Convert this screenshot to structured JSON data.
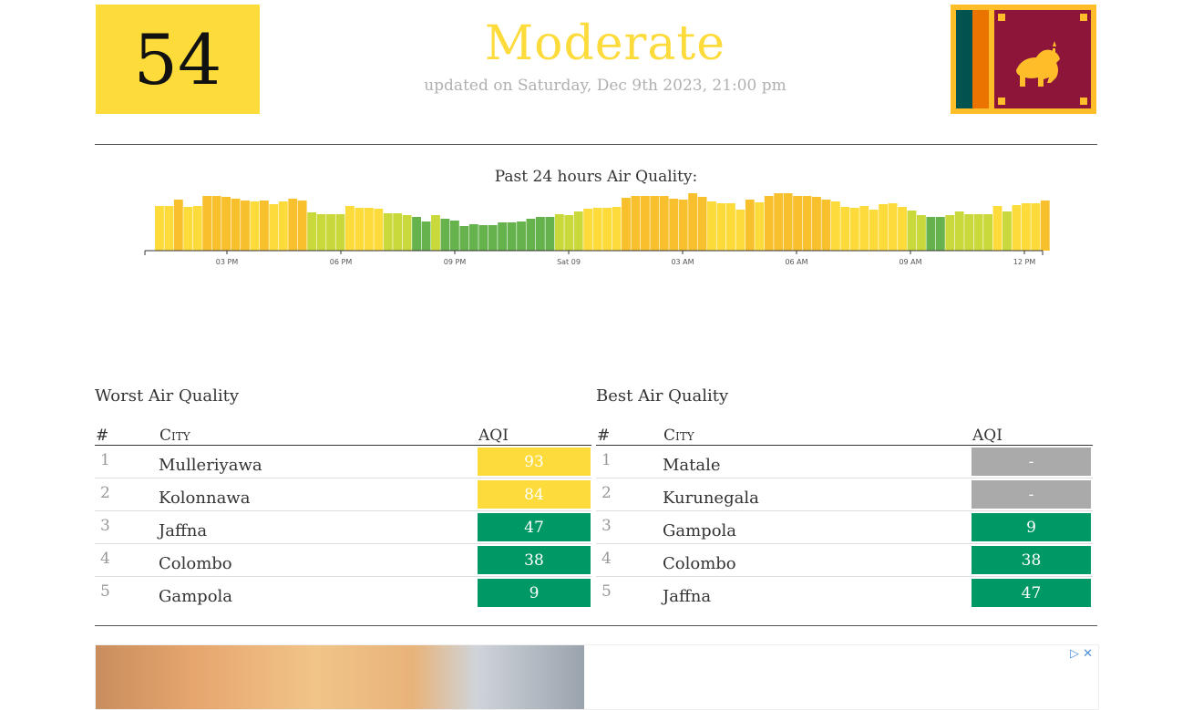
{
  "summary": {
    "aqi_value": "54",
    "aqi_color": "#fcdb3a",
    "status": "Moderate",
    "updated": "updated on Saturday, Dec 9th 2023, 21:00 pm",
    "flag_icon": "sri-lanka-flag-icon"
  },
  "chart_title": "Past 24 hours Air Quality:",
  "chart_data": {
    "type": "bar",
    "title": "Past 24 hours Air Quality:",
    "tick_labels": [
      "03 PM",
      "06 PM",
      "09 PM",
      "Sat 09",
      "03 AM",
      "06 AM",
      "09 AM",
      "12 PM"
    ],
    "values": [
      49,
      49,
      56,
      48,
      49,
      60,
      60,
      59,
      57,
      55,
      54,
      55,
      51,
      54,
      57,
      55,
      42,
      40,
      40,
      40,
      49,
      47,
      47,
      46,
      41,
      41,
      39,
      37,
      32,
      39,
      35,
      33,
      27,
      29,
      28,
      28,
      31,
      31,
      32,
      35,
      37,
      37,
      40,
      39,
      43,
      46,
      47,
      47,
      48,
      58,
      60,
      60,
      60,
      60,
      57,
      56,
      63,
      59,
      54,
      52,
      52,
      45,
      56,
      53,
      60,
      63,
      63,
      60,
      60,
      59,
      56,
      54,
      48,
      47,
      49,
      45,
      51,
      52,
      48,
      44,
      39,
      37,
      37,
      39,
      43,
      40,
      40,
      40,
      49,
      43,
      50,
      52,
      52,
      55
    ],
    "ylim": [
      0,
      70
    ],
    "colors": {
      "good": "#66b34e",
      "moderate_low": "#c9d83a",
      "moderate": "#fcdb3a",
      "moderate_high": "#f8c02c"
    }
  },
  "worst": {
    "title": "Worst Air Quality",
    "headers": {
      "rank": "#",
      "city": "City",
      "aqi": "AQI"
    },
    "rows": [
      {
        "rank": "1",
        "city": "Mulleriyawa",
        "aqi": "93",
        "color": "#fcdb3a"
      },
      {
        "rank": "2",
        "city": "Kolonnawa",
        "aqi": "84",
        "color": "#fcdb3a"
      },
      {
        "rank": "3",
        "city": "Jaffna",
        "aqi": "47",
        "color": "#009966"
      },
      {
        "rank": "4",
        "city": "Colombo",
        "aqi": "38",
        "color": "#009966"
      },
      {
        "rank": "5",
        "city": "Gampola",
        "aqi": "9",
        "color": "#009966"
      }
    ]
  },
  "best": {
    "title": "Best Air Quality",
    "headers": {
      "rank": "#",
      "city": "City",
      "aqi": "AQI"
    },
    "rows": [
      {
        "rank": "1",
        "city": "Matale",
        "aqi": "-",
        "color": "#aaaaaa"
      },
      {
        "rank": "2",
        "city": "Kurunegala",
        "aqi": "-",
        "color": "#aaaaaa"
      },
      {
        "rank": "3",
        "city": "Gampola",
        "aqi": "9",
        "color": "#009966"
      },
      {
        "rank": "4",
        "city": "Colombo",
        "aqi": "38",
        "color": "#009966"
      },
      {
        "rank": "5",
        "city": "Jaffna",
        "aqi": "47",
        "color": "#009966"
      }
    ]
  },
  "ad": {
    "adchoices_icon": "adchoices-icon",
    "close_icon": "close-icon",
    "image": "burger-ad-image"
  }
}
